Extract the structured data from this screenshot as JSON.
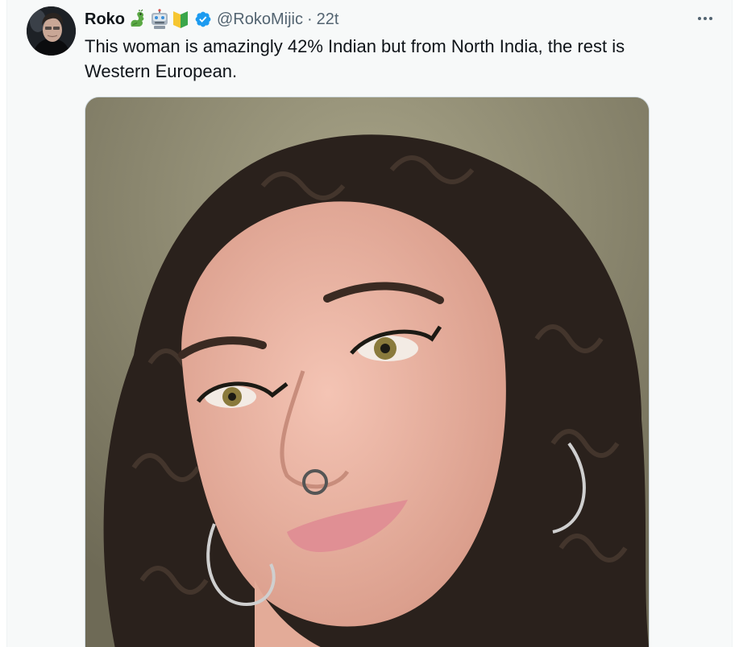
{
  "tweet": {
    "display_name": "Roko",
    "emojis": [
      "dragon-emoji",
      "robot-emoji",
      "beginner-emoji"
    ],
    "handle": "@RokoMijic",
    "separator": "·",
    "time": "22t",
    "text": "This woman is amazingly 42% Indian but from North India, the rest is Western European.",
    "verified_color": "#1d9bf0"
  },
  "icons": {
    "more": "more-horizontal-icon",
    "verified": "verified-badge-icon"
  },
  "colors": {
    "background": "#f7f9f9",
    "text": "#0f1419",
    "secondary_text": "#536471",
    "accent": "#1d9bf0"
  }
}
